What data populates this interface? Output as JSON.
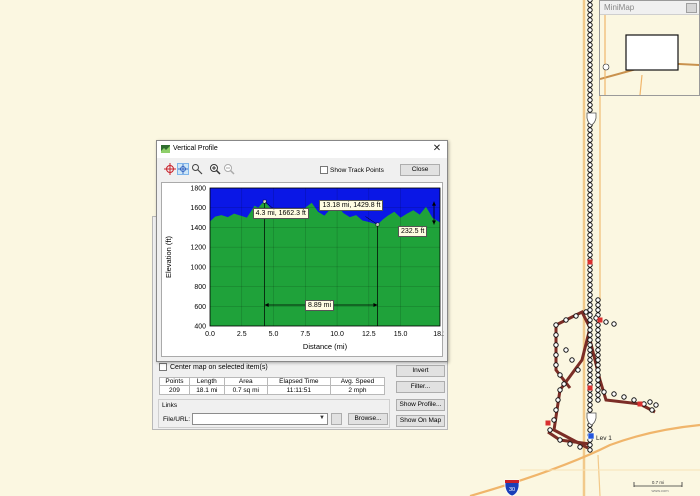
{
  "minimap": {
    "title": "MiniMap"
  },
  "map": {
    "waypoint_label": "Lev 1",
    "shield_number": "30",
    "scale_label": "0.7 mi",
    "scale_sub": "www.com"
  },
  "vertical_profile": {
    "title": "Vertical Profile",
    "show_track_points_label": "Show Track Points",
    "show_track_points_checked": false,
    "close_button": "Close",
    "annotations": {
      "point1": "4.3 mi, 1662.3 ft",
      "point2": "13.18 mi, 1429.8 ft",
      "delta_distance": "8.89 mi",
      "delta_elevation": "232.5 ft"
    }
  },
  "properties": {
    "center_map_label": "Center map on selected item(s)",
    "stats": {
      "headers": [
        "Points",
        "Length",
        "Area",
        "Elapsed Time",
        "Avg. Speed"
      ],
      "values": [
        "209",
        "18.1 mi",
        "0.7 sq mi",
        "11:11:51",
        "2 mph"
      ]
    },
    "links_label": "Links",
    "file_url_label": "File/URL:",
    "file_url_value": "",
    "buttons": {
      "browse": "Browse...",
      "invert": "Invert",
      "filter": "Filter...",
      "show_profile": "Show Profile...",
      "show_on_map": "Show On Map"
    }
  },
  "colors": {
    "sky": "#0a17e6",
    "terrain": "#1fa23a",
    "map_background": "#fbf7e1",
    "track": "#7b2d26"
  },
  "chart_data": {
    "type": "area",
    "xlabel": "Distance   (mi)",
    "ylabel": "Elevation (ft)",
    "xlim": [
      0,
      18.1
    ],
    "ylim": [
      400,
      1800
    ],
    "xticks": [
      "0.0",
      "2.5",
      "5.0",
      "7.5",
      "10.0",
      "12.5",
      "15.0",
      "18.1"
    ],
    "yticks": [
      "400",
      "600",
      "800",
      "1000",
      "1200",
      "1400",
      "1600",
      "1800"
    ],
    "series": [
      {
        "x": [
          0,
          0.4,
          0.9,
          1.4,
          1.9,
          2.4,
          2.9,
          3.2,
          3.5,
          3.8,
          4.1,
          4.3,
          4.6,
          5.0,
          5.5,
          6.0,
          6.5,
          7.0,
          7.5,
          8.0,
          8.5,
          9.0,
          9.5,
          10.0,
          10.5,
          11.0,
          11.5,
          12.0,
          12.5,
          13.18,
          13.6,
          14.0,
          14.5,
          15.0,
          15.5,
          16.0,
          16.5,
          17.0,
          17.5,
          18.1
        ],
        "y": [
          1460,
          1510,
          1525,
          1505,
          1540,
          1520,
          1500,
          1560,
          1620,
          1600,
          1645,
          1662,
          1620,
          1560,
          1590,
          1540,
          1575,
          1510,
          1600,
          1650,
          1560,
          1520,
          1590,
          1620,
          1545,
          1505,
          1525,
          1470,
          1455,
          1430,
          1480,
          1520,
          1560,
          1500,
          1540,
          1575,
          1530,
          1610,
          1500,
          1450
        ]
      }
    ]
  }
}
